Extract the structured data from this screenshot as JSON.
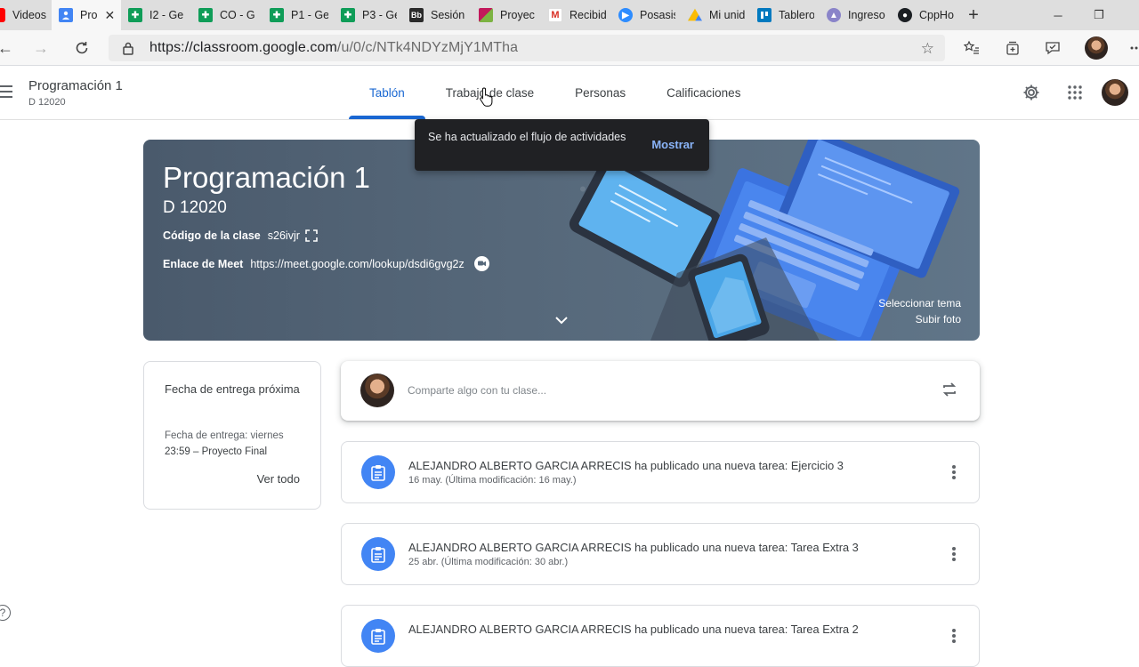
{
  "browser": {
    "tabs": [
      {
        "label": "Videos",
        "icon": "youtube-icon",
        "color": "#ff0000"
      },
      {
        "label": "Pro",
        "icon": "classroom-icon",
        "color": "#4285f4",
        "active": true
      },
      {
        "label": "I2 - Ge",
        "icon": "sheets-icon",
        "color": "#0f9d58"
      },
      {
        "label": "CO - G",
        "icon": "sheets-icon",
        "color": "#0f9d58"
      },
      {
        "label": "P1 - Ge",
        "icon": "sheets-icon",
        "color": "#0f9d58"
      },
      {
        "label": "P3 - Ge",
        "icon": "sheets-icon",
        "color": "#0f9d58"
      },
      {
        "label": "Sesión",
        "icon": "blackboard-icon",
        "color": "#2b2b2b"
      },
      {
        "label": "Proyec",
        "icon": "project-icon",
        "color": "#c2185b"
      },
      {
        "label": "Recibid",
        "icon": "gmail-icon",
        "color": "#d93025"
      },
      {
        "label": "Posasis",
        "icon": "zoom-icon",
        "color": "#2d8cff"
      },
      {
        "label": "Mi unid",
        "icon": "drive-icon",
        "color": "#fbbc04"
      },
      {
        "label": "Tablero",
        "icon": "trello-icon",
        "color": "#0079bf"
      },
      {
        "label": "Ingreso",
        "icon": "ingreso-icon",
        "color": "#6a5acd"
      },
      {
        "label": "CppHo",
        "icon": "github-icon",
        "color": "#1b1f23"
      }
    ],
    "url_host": "https://classroom.google.com",
    "url_path": "/u/0/c/NTk4NDYzMjY1MTha"
  },
  "header": {
    "course_title": "Programación 1",
    "course_section": "D 12020",
    "tabs": [
      "Tablón",
      "Trabajo de clase",
      "Personas",
      "Calificaciones"
    ],
    "active_tab": "Tablón"
  },
  "toast": {
    "message": "Se ha actualizado el flujo de actividades",
    "action": "Mostrar"
  },
  "banner": {
    "title": "Programación 1",
    "section": "D 12020",
    "class_code_label": "Código de la clase",
    "class_code": "s26ivjr",
    "meet_label": "Enlace de Meet",
    "meet_link": "https://meet.google.com/lookup/dsdi6gvg2z",
    "select_theme": "Seleccionar tema",
    "upload_photo": "Subir foto",
    "colors": {
      "bg": "#56687a",
      "device_blue": "#3f7ee8",
      "screen": "#7ec3f2"
    }
  },
  "upcoming": {
    "title": "Fecha de entrega próxima",
    "due_line": "Fecha de entrega: viernes",
    "item": "23:59 – Proyecto Final",
    "view_all": "Ver todo"
  },
  "share": {
    "placeholder": "Comparte algo con tu clase..."
  },
  "stream": [
    {
      "title": "ALEJANDRO ALBERTO GARCIA ARRECIS ha publicado una nueva tarea: Ejercicio 3",
      "date": "16 may. (Última modificación: 16 may.)"
    },
    {
      "title": "ALEJANDRO ALBERTO GARCIA ARRECIS ha publicado una nueva tarea: Tarea Extra 3",
      "date": "25 abr. (Última modificación: 30 abr.)"
    },
    {
      "title": "ALEJANDRO ALBERTO GARCIA ARRECIS ha publicado una nueva tarea: Tarea Extra 2",
      "date": ""
    }
  ],
  "colors": {
    "accent": "#1967d2",
    "assignment_icon": "#4285f4",
    "toast_bg": "#202124",
    "toast_action": "#8ab4f8"
  }
}
